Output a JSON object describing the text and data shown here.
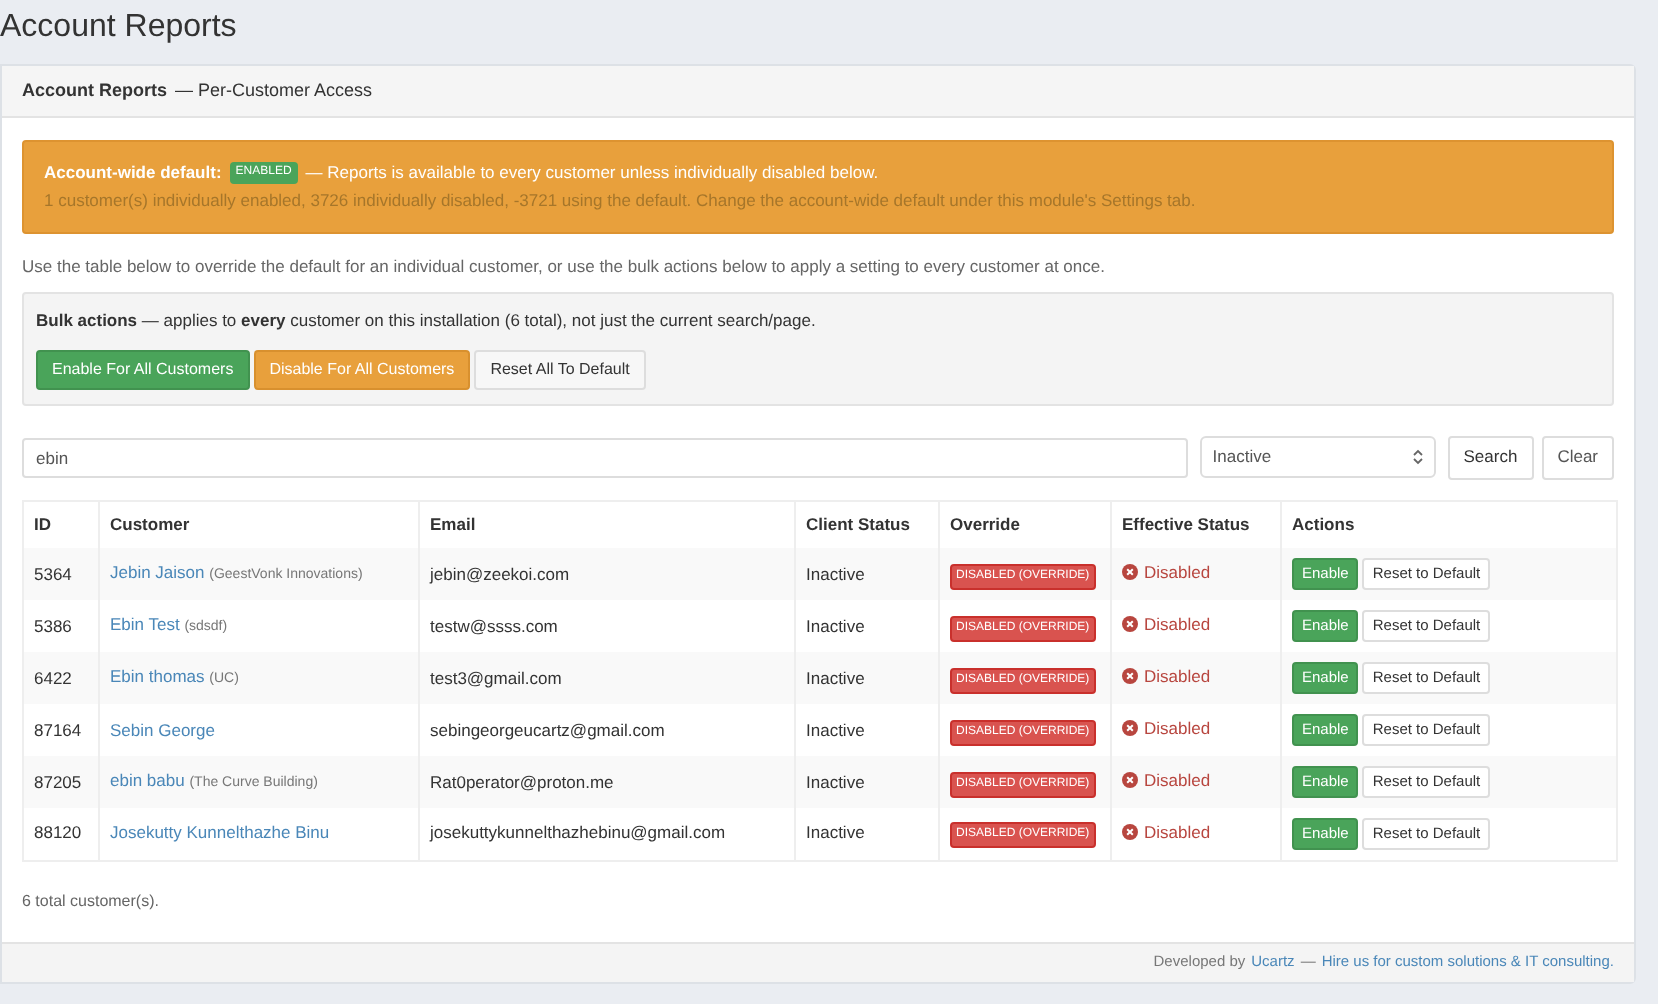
{
  "page_title": "Account Reports",
  "panel": {
    "title": "Account Reports",
    "subtitle": "— Per-Customer Access"
  },
  "alert": {
    "label": "Account-wide default:",
    "badge": "ENABLED",
    "text": "— Reports is available to every customer unless individually disabled below.",
    "detail": "1 customer(s) individually enabled, 3726 individually disabled, -3721 using the default. Change the account-wide default under this module's Settings tab."
  },
  "intro": "Use the table below to override the default for an individual customer, or use the bulk actions below to apply a setting to every customer at once.",
  "bulk": {
    "text": "**Bulk actions** — applies to **every** customer on this installation (6 total), not just the current search/page.",
    "buttons": [
      {
        "label": "Enable For All Customers",
        "kind": "success"
      },
      {
        "label": "Disable For All Customers",
        "kind": "warning"
      },
      {
        "label": "Reset All To Default",
        "kind": "default"
      }
    ]
  },
  "search": {
    "value": "ebin",
    "filter": "Inactive",
    "buttons": [
      "Search",
      "Clear"
    ]
  },
  "table": {
    "columns": [
      "ID",
      "Customer",
      "Email",
      "Client Status",
      "Override",
      "Effective Status",
      "Actions"
    ],
    "rows": [
      {
        "id": "5364",
        "name": "Jebin Jaison",
        "company": "(GeestVonk Innovations)",
        "email": "jebin@zeekoi.com",
        "client_status": "Inactive",
        "override": {
          "label": "DISABLED (OVERRIDE)",
          "kind": "disabled"
        },
        "effective": {
          "label": "Disabled",
          "kind": "disabled"
        },
        "actions": [
          "Enable",
          "Reset to Default"
        ]
      },
      {
        "id": "5386",
        "name": "Ebin Test",
        "company": "(sdsdf)",
        "email": "testw@ssss.com",
        "client_status": "Inactive",
        "override": {
          "label": "DISABLED (OVERRIDE)",
          "kind": "disabled"
        },
        "effective": {
          "label": "Disabled",
          "kind": "disabled"
        },
        "actions": [
          "Enable",
          "Reset to Default"
        ]
      },
      {
        "id": "6422",
        "name": "Ebin thomas",
        "company": "(UC)",
        "email": "test3@gmail.com",
        "client_status": "Inactive",
        "override": {
          "label": "DISABLED (OVERRIDE)",
          "kind": "disabled"
        },
        "effective": {
          "label": "Disabled",
          "kind": "disabled"
        },
        "actions": [
          "Enable",
          "Reset to Default"
        ]
      },
      {
        "id": "87164",
        "name": "Sebin George",
        "email": "sebingeorgeucartz@gmail.com",
        "client_status": "Inactive",
        "override": {
          "label": "DISABLED (OVERRIDE)",
          "kind": "disabled"
        },
        "effective": {
          "label": "Disabled",
          "kind": "disabled"
        },
        "actions": [
          "Enable",
          "Reset to Default"
        ]
      },
      {
        "id": "87205",
        "name": "ebin babu",
        "company": "(The Curve Building)",
        "email": "Rat0perator@proton.me",
        "client_status": "Inactive",
        "override": {
          "label": "DISABLED (OVERRIDE)",
          "kind": "disabled"
        },
        "effective": {
          "label": "Disabled",
          "kind": "disabled"
        },
        "actions": [
          "Enable",
          "Reset to Default"
        ]
      },
      {
        "id": "88120",
        "name": "Josekutty Kunnelthazhe Binu",
        "email": "josekuttykunnelthazhebinu@gmail.com",
        "client_status": "Inactive",
        "override": {
          "label": "DISABLED (OVERRIDE)",
          "kind": "disabled"
        },
        "effective": {
          "label": "Disabled",
          "kind": "disabled"
        },
        "actions": [
          "Enable",
          "Reset to Default"
        ]
      }
    ]
  },
  "total": "6 total customer(s).",
  "footer": {
    "prefix": "Developed by",
    "link": "Ucartz",
    "separator": "—",
    "cta": "Hire us for custom solutions & IT consulting."
  }
}
